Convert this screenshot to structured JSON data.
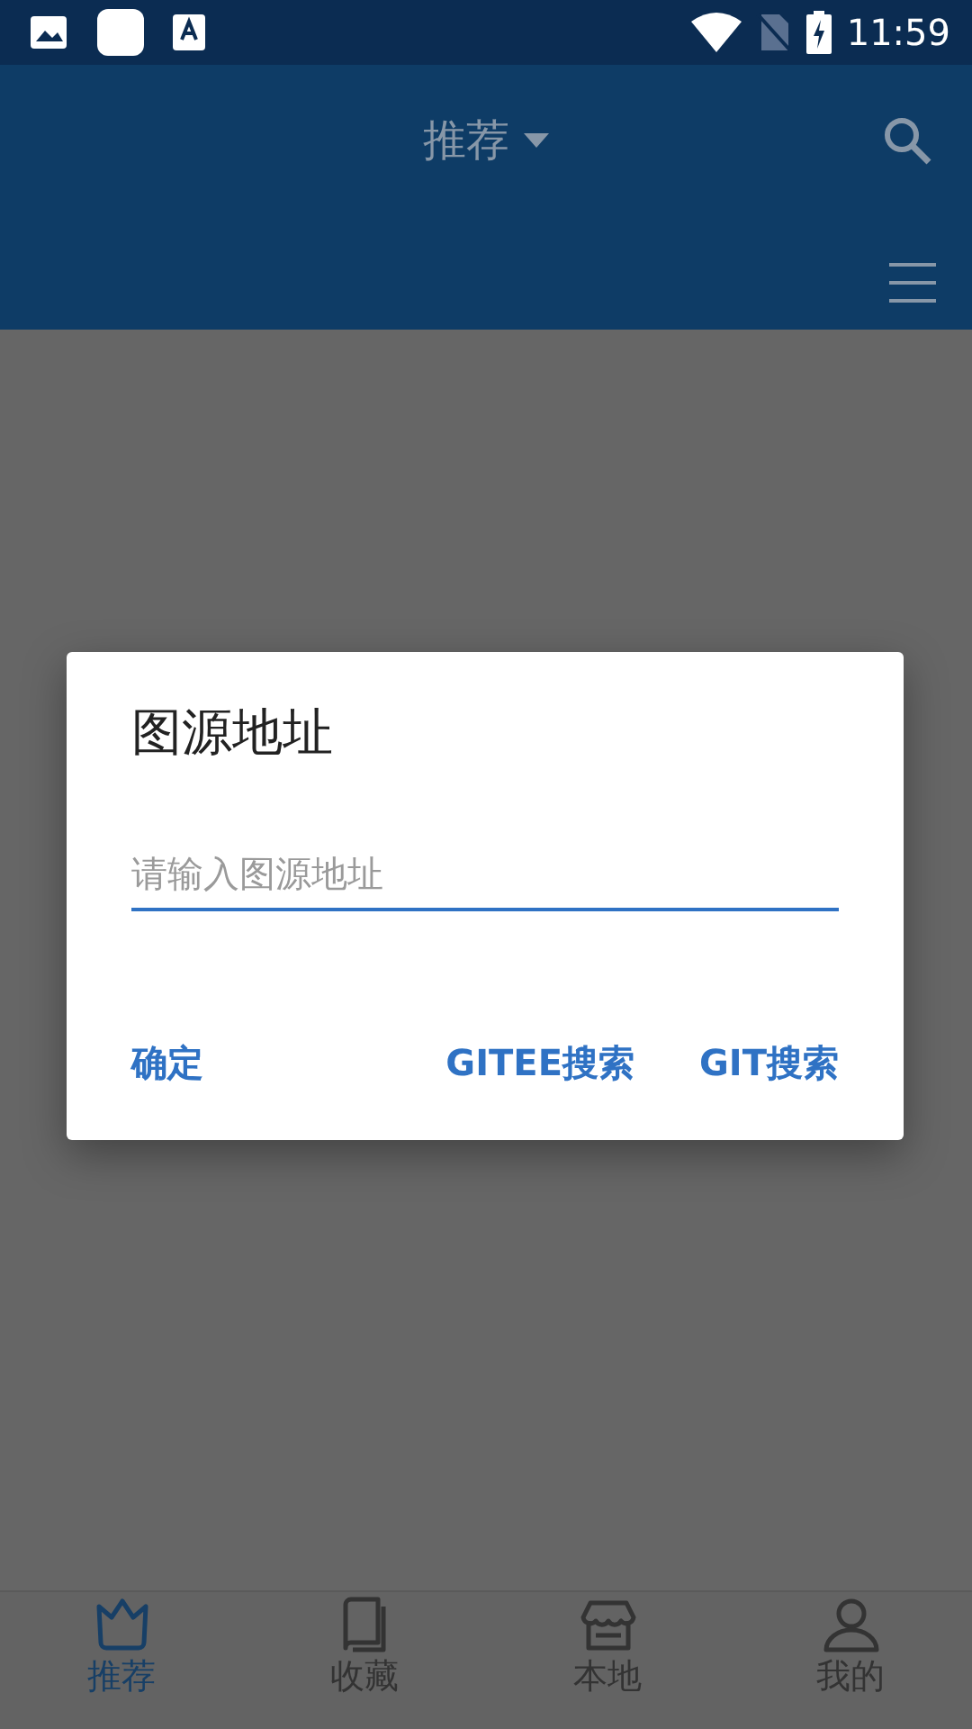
{
  "status_bar": {
    "time": "11:59"
  },
  "header": {
    "title": "推荐"
  },
  "dialog": {
    "title": "图源地址",
    "input": {
      "placeholder": "请输入图源地址"
    },
    "buttons": [
      {
        "label": "确定"
      },
      {
        "label": "GITEE搜索"
      },
      {
        "label": "GIT搜索"
      }
    ]
  },
  "bottom_nav": [
    {
      "label": "推荐",
      "selected": true
    },
    {
      "label": "收藏",
      "selected": false
    },
    {
      "label": "本地",
      "selected": false
    },
    {
      "label": "我的",
      "selected": false
    }
  ]
}
